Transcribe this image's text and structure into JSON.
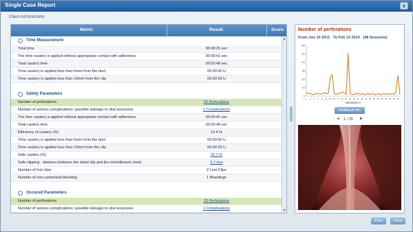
{
  "window": {
    "title": "Single Case Report",
    "close_glyph": "x",
    "user_label": "Client Administrator"
  },
  "table": {
    "headers": {
      "metric": "Metric",
      "result": "Result",
      "score": "Score"
    },
    "sections": [
      {
        "title": "Time Measurement",
        "rows": [
          {
            "metric": "Total time",
            "result": "00:49:25 sec",
            "link": false,
            "highlight": false
          },
          {
            "metric": "The time cautery is applied without appropriate contact with adhesions",
            "result": "00:00:41 sec",
            "link": false,
            "highlight": false
          },
          {
            "metric": "Total cautery time",
            "result": "00:00:48 sec",
            "link": false,
            "highlight": false
          },
          {
            "metric": "Time cautery is applied less than 5mm from the duct",
            "result": "00:00:00 U",
            "link": false,
            "highlight": false
          },
          {
            "metric": "Time cautery is applied less than 15mm from the clip",
            "result": "00:00:33 U",
            "link": false,
            "highlight": false
          }
        ]
      },
      {
        "title": "Safety Parameters",
        "rows": [
          {
            "metric": "Number of perforations",
            "result": "25 Perforations",
            "link": true,
            "highlight": true
          },
          {
            "metric": "Number of serious complications: possible damage to vital structures",
            "result": "1 Complications",
            "link": true,
            "highlight": false
          },
          {
            "metric": "The time cautery is applied without appropriate contact with adhesions",
            "result": "00:00:41 sec",
            "link": false,
            "highlight": false
          },
          {
            "metric": "Total cautery time",
            "result": "00:00:48 sec",
            "link": false,
            "highlight": false
          },
          {
            "metric": "Efficiency of cautery (%)",
            "result": "14.4 %",
            "link": false,
            "highlight": false
          },
          {
            "metric": "Time cautery is applied less than 5mm from the duct",
            "result": "00:00:00 U",
            "link": false,
            "highlight": false
          },
          {
            "metric": "Time cautery is applied less than 15mm from the clip",
            "result": "00:00:33 U",
            "link": false,
            "highlight": false
          },
          {
            "metric": "Safe cautery (%)",
            "result": "32.1 %",
            "link": true,
            "highlight": false
          },
          {
            "metric": "Safe clipping - distance between the distal clip and the infundibulum (mm)",
            "result": "3.7 mm",
            "link": true,
            "highlight": false
          },
          {
            "metric": "Number of lost clips",
            "result": "2 Lost Clips",
            "link": false,
            "highlight": false
          },
          {
            "metric": "Number of non-cauterized bleeding",
            "result": "1 Bleedings",
            "link": false,
            "highlight": false
          }
        ]
      },
      {
        "title": "Occured Parameters",
        "rows": [
          {
            "metric": "Number of perforations",
            "result": "25 Perforations",
            "link": true,
            "highlight": true
          },
          {
            "metric": "Number of serious complications: possible damage to vital structures",
            "result": "1 Complications",
            "link": true,
            "highlight": false
          },
          {
            "metric": "The time cautery is applied without appropriate contact with adhesions",
            "result": "00:00:41 sec",
            "link": false,
            "highlight": false
          }
        ]
      }
    ]
  },
  "side": {
    "title": "Number of perforations",
    "range_from": "From Jun 10 2011",
    "range_to": "To Feb 13 2014",
    "sessions": "(48 Sessions)",
    "additional_info": "Additional Info",
    "page": "1 / 25",
    "prev_glyph": "◀",
    "next_glyph": "▶"
  },
  "chart_data": {
    "type": "line",
    "title": "",
    "xlabel": "Sessions #",
    "ylabel": "",
    "ylim": [
      0,
      60
    ],
    "yticks": [
      0,
      10,
      20,
      30,
      40,
      50,
      60
    ],
    "x": [
      1,
      2,
      3,
      4,
      5,
      6,
      7,
      8,
      9,
      10,
      11,
      12,
      13,
      14,
      15,
      16,
      17,
      18,
      19,
      20,
      21,
      22,
      23,
      24,
      25,
      26,
      27,
      28,
      29,
      30,
      31,
      32,
      33,
      34,
      35,
      36,
      37,
      38,
      39,
      40,
      41,
      42,
      43,
      44,
      45,
      46,
      47,
      48
    ],
    "xtick_labels": [
      "1",
      "3",
      "5",
      "7",
      "9",
      "11",
      "13",
      "15",
      "17",
      "19",
      "21",
      "23",
      "25",
      "27",
      "29",
      "31",
      "33",
      "35",
      "37",
      "39",
      "41",
      "43",
      "45",
      "47"
    ],
    "series": [
      {
        "values": [
          4,
          3,
          3,
          2,
          2,
          3,
          3,
          2,
          3,
          4,
          3,
          3,
          22,
          25,
          3,
          2,
          3,
          3,
          5,
          4,
          2,
          50,
          3,
          2,
          2,
          3,
          3,
          2,
          3,
          2,
          2,
          3,
          2,
          3,
          2,
          2,
          3,
          2,
          2,
          3,
          2,
          3,
          2,
          3,
          2,
          5,
          24,
          2
        ],
        "color": "#c8851e"
      }
    ],
    "grid": false
  },
  "footer": {
    "print": "Print",
    "close": "Close"
  },
  "colors": {
    "accent": "#1f4f86",
    "highlight_row": "#d6e7b5",
    "title_bar": "#2a68aa",
    "chart_line": "#c8851e",
    "chart_title": "#b03010"
  }
}
